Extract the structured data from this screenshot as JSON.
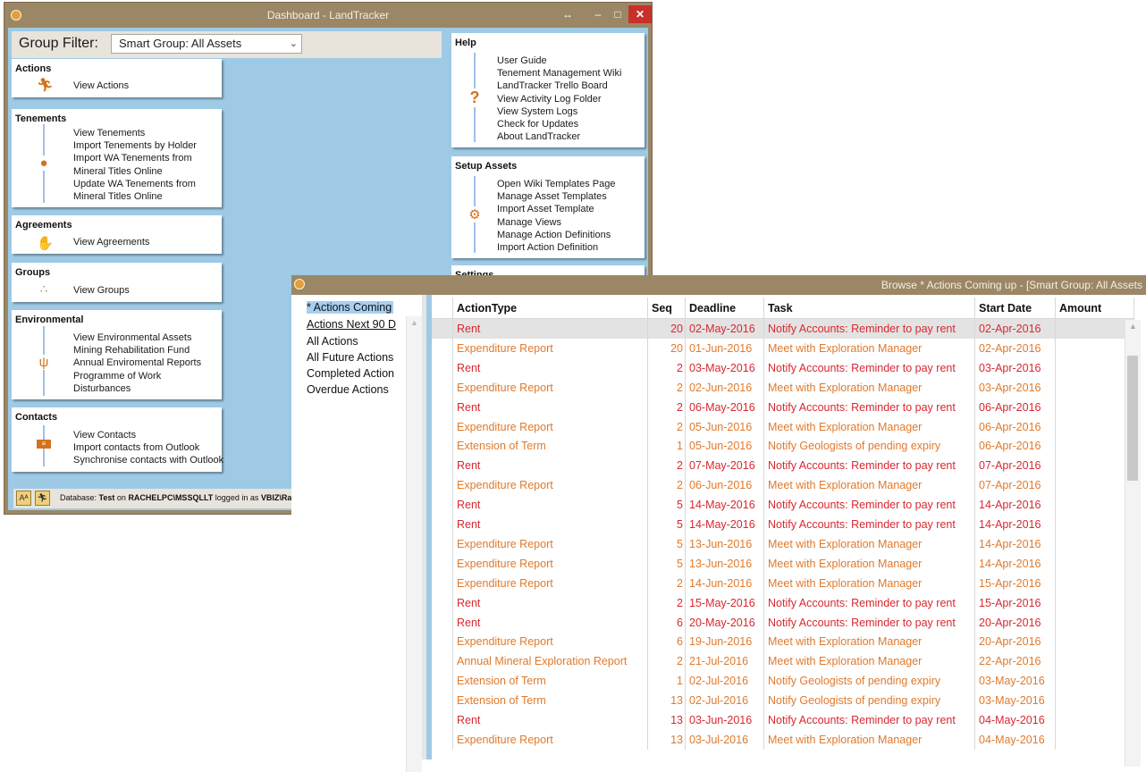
{
  "dashboard": {
    "title": "Dashboard - LandTracker",
    "filter_label": "Group Filter:",
    "filter_value": "Smart Group: All Assets",
    "panels": {
      "actions": {
        "title": "Actions",
        "icon": "running-person-icon",
        "items": [
          "View Actions"
        ]
      },
      "tenements": {
        "title": "Tenements",
        "icon": "map-pin-icon",
        "items": [
          "View Tenements",
          "Import Tenements by Holder",
          "Import WA Tenements from",
          "Mineral Titles Online",
          "Update WA Tenements from",
          "Mineral Titles Online"
        ]
      },
      "agreements": {
        "title": "Agreements",
        "icon": "handshake-icon",
        "items": [
          "View Agreements"
        ]
      },
      "groups": {
        "title": "Groups",
        "icon": "group-dots-icon",
        "items": [
          "View Groups"
        ]
      },
      "environmental": {
        "title": "Environmental",
        "icon": "grass-icon",
        "items": [
          "View Environmental Assets",
          "Mining Rehabilitation Fund",
          "Annual Enviromental Reports",
          "Programme of Work",
          "Disturbances"
        ]
      },
      "contacts": {
        "title": "Contacts",
        "icon": "contact-card-icon",
        "items": [
          "View Contacts",
          "Import contacts from Outlook",
          "Synchronise contacts with Outlook"
        ]
      },
      "help": {
        "title": "Help",
        "icon": "question-mark-icon",
        "items": [
          "User Guide",
          "Tenement Management Wiki",
          "LandTracker Trello Board",
          "View Activity Log Folder",
          "View System Logs",
          "Check for Updates",
          "About LandTracker"
        ]
      },
      "setup": {
        "title": "Setup Assets",
        "icon": "gear-icon",
        "items": [
          "Open Wiki Templates Page",
          "Manage Asset Templates",
          "Import Asset Template",
          "Manage Views",
          "Manage Action Definitions",
          "Import Action Definition"
        ]
      },
      "settings": {
        "title": "Settings"
      }
    },
    "status": {
      "font_button": "Aᴬ",
      "prefix": "Database:",
      "database": "Test",
      "on": "on",
      "server": "RACHELPC\\MSSQLLT",
      "logged": "logged in as",
      "user": "VBIZ\\Rachel"
    }
  },
  "browse": {
    "title": "Browse * Actions Coming up - [Smart Group: All Assets",
    "views": [
      "* Actions Coming",
      "Actions Next 90 D",
      "All Actions",
      "All Future Actions",
      "Completed Action",
      "Overdue Actions"
    ],
    "columns": [
      "ActionType",
      "Seq",
      "Deadline",
      "Task",
      "Start Date",
      "Amount"
    ],
    "rows": [
      [
        "Rent",
        "20",
        "02-May-2016",
        "Notify Accounts: Reminder to pay rent",
        "02-Apr-2016",
        ""
      ],
      [
        "Expenditure Report",
        "20",
        "01-Jun-2016",
        "Meet with Exploration Manager",
        "02-Apr-2016",
        ""
      ],
      [
        "Rent",
        "2",
        "03-May-2016",
        "Notify Accounts: Reminder to pay rent",
        "03-Apr-2016",
        ""
      ],
      [
        "Expenditure Report",
        "2",
        "02-Jun-2016",
        "Meet with Exploration Manager",
        "03-Apr-2016",
        ""
      ],
      [
        "Rent",
        "2",
        "06-May-2016",
        "Notify Accounts: Reminder to pay rent",
        "06-Apr-2016",
        ""
      ],
      [
        "Expenditure Report",
        "2",
        "05-Jun-2016",
        "Meet with Exploration Manager",
        "06-Apr-2016",
        ""
      ],
      [
        "Extension of Term",
        "1",
        "05-Jun-2016",
        "Notify Geologists of pending expiry",
        "06-Apr-2016",
        ""
      ],
      [
        "Rent",
        "2",
        "07-May-2016",
        "Notify Accounts: Reminder to pay rent",
        "07-Apr-2016",
        ""
      ],
      [
        "Expenditure Report",
        "2",
        "06-Jun-2016",
        "Meet with Exploration Manager",
        "07-Apr-2016",
        ""
      ],
      [
        "Rent",
        "5",
        "14-May-2016",
        "Notify Accounts: Reminder to pay rent",
        "14-Apr-2016",
        ""
      ],
      [
        "Rent",
        "5",
        "14-May-2016",
        "Notify Accounts: Reminder to pay rent",
        "14-Apr-2016",
        ""
      ],
      [
        "Expenditure Report",
        "5",
        "13-Jun-2016",
        "Meet with Exploration Manager",
        "14-Apr-2016",
        ""
      ],
      [
        "Expenditure Report",
        "5",
        "13-Jun-2016",
        "Meet with Exploration Manager",
        "14-Apr-2016",
        ""
      ],
      [
        "Expenditure Report",
        "2",
        "14-Jun-2016",
        "Meet with Exploration Manager",
        "15-Apr-2016",
        ""
      ],
      [
        "Rent",
        "2",
        "15-May-2016",
        "Notify Accounts: Reminder to pay rent",
        "15-Apr-2016",
        ""
      ],
      [
        "Rent",
        "6",
        "20-May-2016",
        "Notify Accounts: Reminder to pay rent",
        "20-Apr-2016",
        ""
      ],
      [
        "Expenditure Report",
        "6",
        "19-Jun-2016",
        "Meet with Exploration Manager",
        "20-Apr-2016",
        ""
      ],
      [
        "Annual Mineral Exploration Report",
        "2",
        "21-Jul-2016",
        "Meet with Exploration Manager",
        "22-Apr-2016",
        ""
      ],
      [
        "Extension of Term",
        "1",
        "02-Jul-2016",
        "Notify Geologists of pending expiry",
        "03-May-2016",
        ""
      ],
      [
        "Extension of Term",
        "13",
        "02-Jul-2016",
        "Notify Geologists of pending expiry",
        "03-May-2016",
        ""
      ],
      [
        "Rent",
        "13",
        "03-Jun-2016",
        "Notify Accounts: Reminder to pay rent",
        "04-May-2016",
        ""
      ],
      [
        "Expenditure Report",
        "13",
        "03-Jul-2016",
        "Meet with Exploration Manager",
        "04-May-2016",
        ""
      ]
    ],
    "colors": {
      "rent": "#d9282f",
      "orange": "#e07a2c",
      "selected_row": "#e3e3e3"
    }
  }
}
